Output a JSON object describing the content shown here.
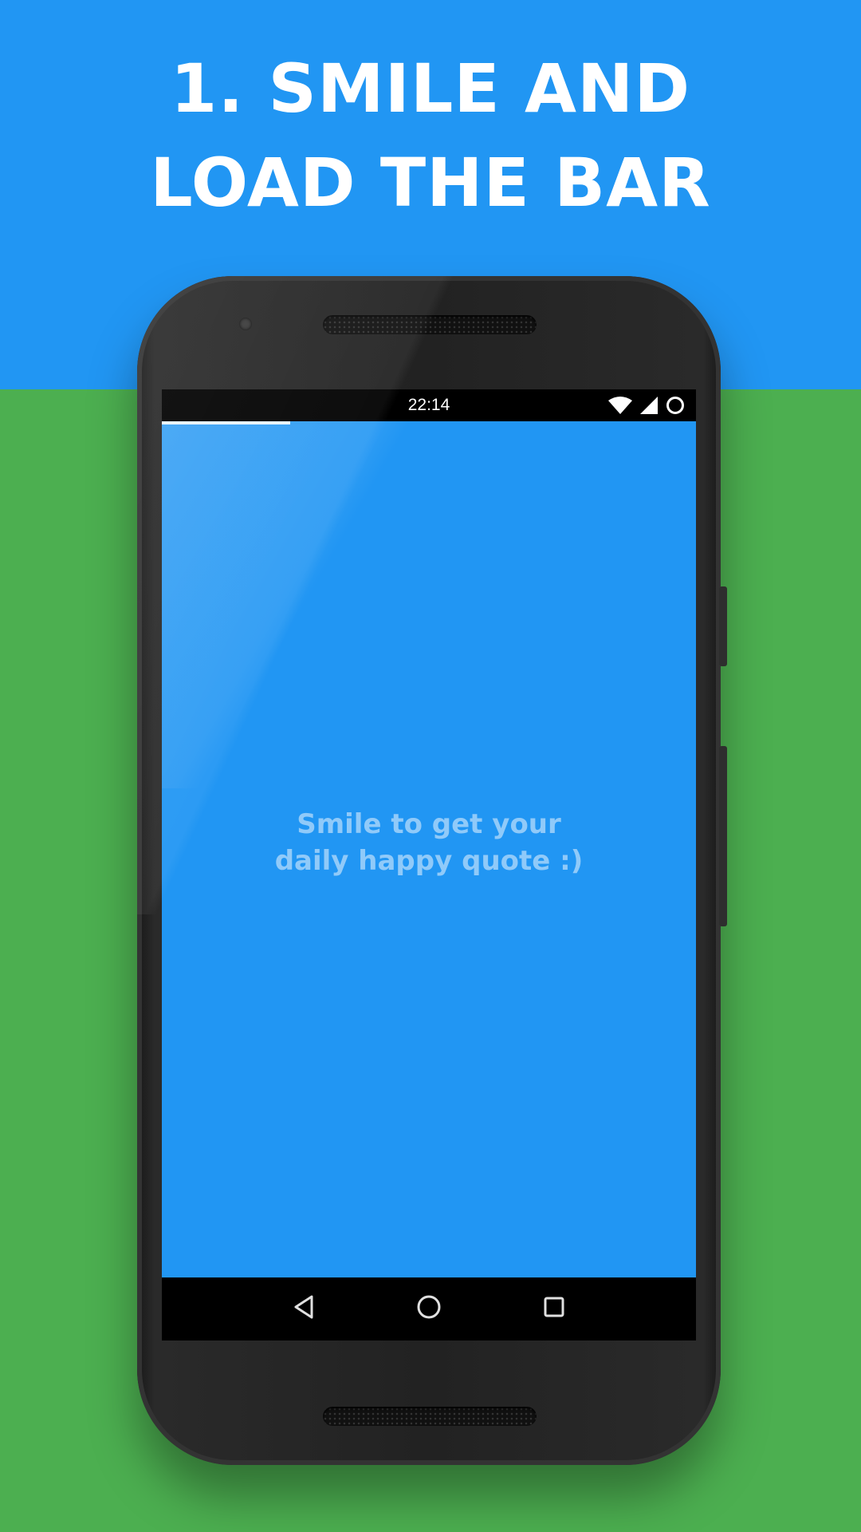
{
  "headline": {
    "line1": "1. SMILE AND",
    "line2": "LOAD THE BAR"
  },
  "colors": {
    "top_background": "#2196f3",
    "bottom_background": "#4caf50",
    "app_background": "#2196f3",
    "prompt_text": "#90caf9"
  },
  "status_bar": {
    "time": "22:14",
    "icons": [
      "wifi-icon",
      "cell-signal-icon",
      "battery-circle-icon"
    ]
  },
  "app": {
    "progress_fraction": 0.24,
    "prompt_line1": "Smile to get your",
    "prompt_line2": "daily happy quote :)"
  },
  "nav_bar": {
    "icons": [
      "back-icon",
      "home-icon",
      "recents-icon"
    ]
  }
}
